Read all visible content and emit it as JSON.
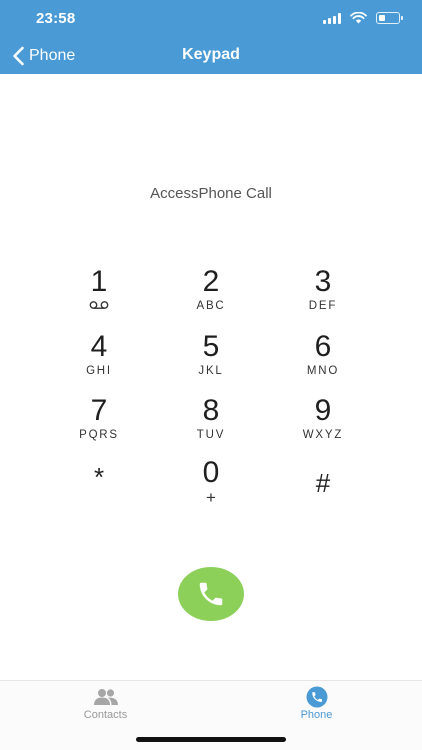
{
  "status_bar": {
    "time": "23:58",
    "signal_icon": "cellular-signal-icon",
    "wifi_icon": "wifi-icon",
    "battery_icon": "battery-icon",
    "battery_level": 0.3
  },
  "nav": {
    "back_label": "Phone",
    "back_icon": "chevron-left-icon",
    "title": "Keypad"
  },
  "display": {
    "text": "AccessPhone Call"
  },
  "keypad": {
    "keys": [
      {
        "digit": "1",
        "letters": "",
        "icon": "voicemail-icon"
      },
      {
        "digit": "2",
        "letters": "ABC"
      },
      {
        "digit": "3",
        "letters": "DEF"
      },
      {
        "digit": "4",
        "letters": "GHI"
      },
      {
        "digit": "5",
        "letters": "JKL"
      },
      {
        "digit": "6",
        "letters": "MNO"
      },
      {
        "digit": "7",
        "letters": "PQRS"
      },
      {
        "digit": "8",
        "letters": "TUV"
      },
      {
        "digit": "9",
        "letters": "WXYZ"
      },
      {
        "digit": "*",
        "letters": ""
      },
      {
        "digit": "0",
        "letters": "+"
      },
      {
        "digit": "#",
        "letters": ""
      }
    ]
  },
  "call_button": {
    "icon": "phone-icon",
    "color": "#8cd05a"
  },
  "tab_bar": {
    "tabs": [
      {
        "label": "Contacts",
        "icon": "contacts-icon",
        "active": false
      },
      {
        "label": "Phone",
        "icon": "phone-circle-icon",
        "active": true
      }
    ]
  },
  "colors": {
    "accent": "#4a9ad6",
    "call_green": "#8cd05a"
  }
}
